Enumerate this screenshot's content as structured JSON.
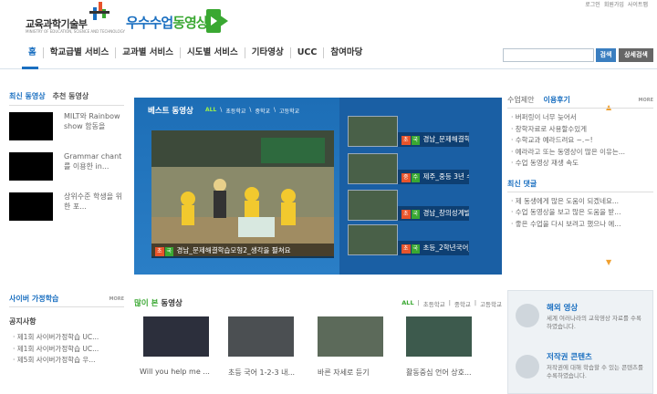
{
  "header": {
    "ministry_name": "교육과학기술부",
    "ministry_sub": "MINISTRY OF EDUCATION, SCIENCE AND TECHNOLOGY",
    "site_name_part1": "우수수업",
    "site_name_part2": "동영상",
    "toplinks": [
      "로그인",
      "회원가입",
      "사이트맵"
    ]
  },
  "nav": {
    "items": [
      "홈",
      "학교급별 서비스",
      "교과별 서비스",
      "시도별 서비스",
      "기타영상",
      "UCC",
      "참여마당"
    ]
  },
  "search": {
    "button": "검색",
    "advanced_button": "상세검색"
  },
  "left": {
    "tab_active": "최신 동영상",
    "tab_inactive": "추천 동영상",
    "videos": [
      "MILT와 Rainbow show 함동을",
      "Grammar chant를 이용한 in...",
      "상위수준 학생을 위한 포..."
    ]
  },
  "best": {
    "title": "베스트 동영상",
    "filters": [
      "ALL",
      "초등학교",
      "중학교",
      "고등학교"
    ],
    "main_badges": [
      "초",
      "국"
    ],
    "main_caption": "경남_문제해결학습모형2_생각을 펼쳐요",
    "items": [
      {
        "badges": [
          "초",
          "국"
        ],
        "label": "경남_문제해결학습"
      },
      {
        "badges": [
          "중",
          "수"
        ],
        "label": "제주_중등 3년 수학"
      },
      {
        "badges": [
          "초",
          "국"
        ],
        "label": "경남_창의성계발학"
      },
      {
        "badges": [
          "초",
          "국"
        ],
        "label": "초등_2학년국어_의"
      }
    ]
  },
  "right": {
    "tab_inactive": "수업제안",
    "tab_active": "이용후기",
    "more": "MORE",
    "reviews": [
      "버퍼링이 너무 늦어서",
      "창학자료로 사용할수있게",
      "수학교과 예라드려요 ~.~!",
      "예라라고 또는 동영상이 많은 이유는...",
      "수업 동영상 재생 속도"
    ],
    "comments_title": "최신 댓글",
    "comments": [
      "제 동생에게 많은 도움이 되겠네요...",
      "수업 동영상을 보고 많은 도움을 받...",
      "좋은 수업을 다시 보려고 했으나 에..."
    ]
  },
  "cyber": {
    "title": "사이버 가정학습",
    "more": "MORE",
    "notice_title": "공지사항",
    "notices": [
      "제1회 사이버가정학습 UC...",
      "제1회 사이버가정학습 UC...",
      "제5회 사이버가정학습 우..."
    ]
  },
  "popular": {
    "title_part1": "많이 본",
    "title_part2": "동영상",
    "filters": [
      "ALL",
      "초등학교",
      "중학교",
      "고등학교"
    ],
    "videos": [
      "Will you help me ...",
      "초등 국어 1-2-3 내...",
      "바른 자세로 듣기",
      "활동중심 언어 상호..."
    ]
  },
  "services": {
    "overseas_title": "해외 영상",
    "overseas_desc": "세계 여러나라의 교육영상 자료를 수록 하였습니다.",
    "copyright_title": "저작권 콘텐츠",
    "copyright_desc": "저작권에 대해 학습할 수 있는 콘텐츠를 수록하였습니다."
  }
}
